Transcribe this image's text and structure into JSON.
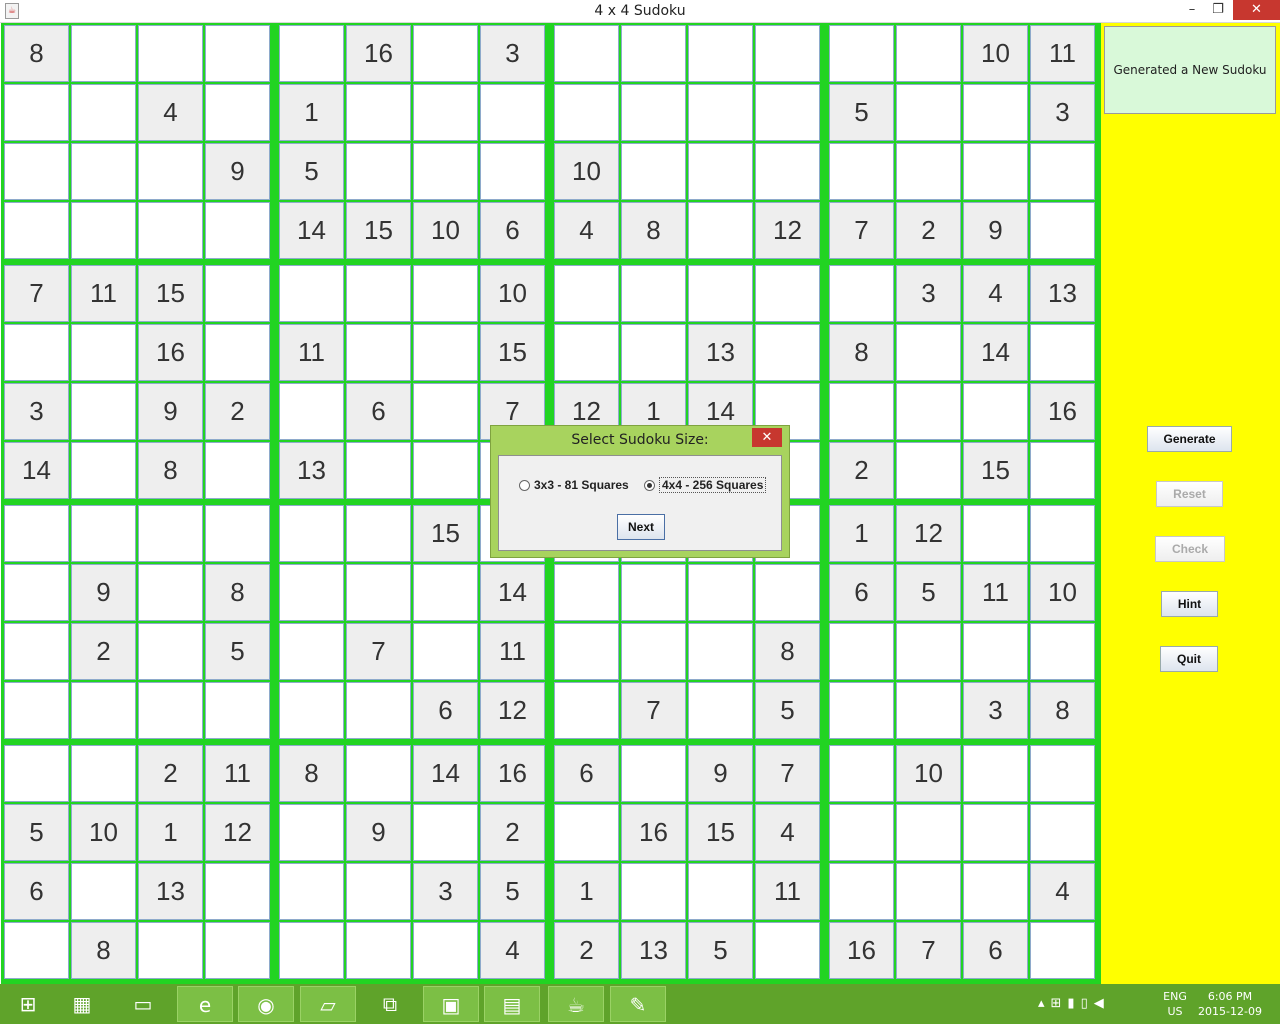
{
  "window": {
    "title": "4 x 4 Sudoku",
    "app_icon": "java-icon",
    "min": "–",
    "max": "❐",
    "close": "✕"
  },
  "grid": [
    [
      "8",
      "",
      "",
      "",
      "",
      "16",
      "",
      "3",
      "",
      "",
      "",
      "",
      "",
      "",
      "10",
      "11"
    ],
    [
      "",
      "",
      "4",
      "",
      "1",
      "",
      "",
      "",
      "",
      "",
      "",
      "",
      "5",
      "",
      "",
      "3"
    ],
    [
      "",
      "",
      "",
      "9",
      "5",
      "",
      "",
      "",
      "10",
      "",
      "",
      "",
      "",
      "",
      "",
      ""
    ],
    [
      "",
      "",
      "",
      "",
      "14",
      "15",
      "10",
      "6",
      "4",
      "8",
      "",
      "12",
      "7",
      "2",
      "9",
      ""
    ],
    [
      "7",
      "11",
      "15",
      "",
      "",
      "",
      "",
      "10",
      "",
      "",
      "",
      "",
      "",
      "3",
      "4",
      "13"
    ],
    [
      "",
      "",
      "16",
      "",
      "11",
      "",
      "",
      "15",
      "",
      "",
      "13",
      "",
      "8",
      "",
      "14",
      ""
    ],
    [
      "3",
      "",
      "9",
      "2",
      "",
      "6",
      "",
      "7",
      "12",
      "1",
      "14",
      "",
      "",
      "",
      "",
      "16"
    ],
    [
      "14",
      "",
      "8",
      "",
      "13",
      "",
      "",
      "",
      "",
      "",
      "",
      "",
      "2",
      "",
      "15",
      ""
    ],
    [
      "",
      "",
      "",
      "",
      "",
      "",
      "15",
      "",
      "",
      "",
      "",
      "",
      "1",
      "12",
      "",
      ""
    ],
    [
      "",
      "9",
      "",
      "8",
      "",
      "",
      "",
      "14",
      "",
      "",
      "",
      "",
      "6",
      "5",
      "11",
      "10"
    ],
    [
      "",
      "2",
      "",
      "5",
      "",
      "7",
      "",
      "11",
      "",
      "",
      "",
      "8",
      "",
      "",
      "",
      ""
    ],
    [
      "",
      "",
      "",
      "",
      "",
      "",
      "6",
      "12",
      "",
      "7",
      "",
      "5",
      "",
      "",
      "3",
      "8"
    ],
    [
      "",
      "",
      "2",
      "11",
      "8",
      "",
      "14",
      "16",
      "6",
      "",
      "9",
      "7",
      "",
      "10",
      "",
      ""
    ],
    [
      "5",
      "10",
      "1",
      "12",
      "",
      "9",
      "",
      "2",
      "",
      "16",
      "15",
      "4",
      "",
      "",
      "",
      ""
    ],
    [
      "6",
      "",
      "13",
      "",
      "",
      "",
      "3",
      "5",
      "1",
      "",
      "",
      "11",
      "",
      "",
      "",
      "4"
    ],
    [
      "",
      "8",
      "",
      "",
      "",
      "",
      "",
      "4",
      "2",
      "13",
      "5",
      "",
      "16",
      "7",
      "6",
      ""
    ]
  ],
  "given_mask": [
    "1000010100000011",
    "0010100000001001",
    "0001100010000000",
    "0000111111011110",
    "1110000100000111",
    "0010100100101010",
    "1011010111100001",
    "1010100000001010",
    "0000001000001100",
    "0101000100001111",
    "0101010100010000",
    "0000001101010011",
    "0011101110110100",
    "1111010101110000",
    "1010001110010001",
    "0100000111101110"
  ],
  "sidebar": {
    "status": "Generated a New Sudoku",
    "buttons": [
      "Generate",
      "Reset",
      "Check",
      "Hint",
      "Quit"
    ],
    "disabled": [
      "Reset",
      "Check"
    ]
  },
  "dialog": {
    "title": "Select Sudoku Size:",
    "close": "✕",
    "option_3x3": "3x3 - 81 Squares",
    "option_4x4": "4x4 - 256 Squares",
    "selected": "4x4 - 256 Squares",
    "next": "Next"
  },
  "taskbar": {
    "items": [
      "windows-start-icon",
      "control-panel-icon",
      "computer-icon",
      "internet-explorer-icon",
      "chrome-icon",
      "sticky-notes-icon",
      "remote-desktop-icon",
      "terminal-icon",
      "file-explorer-icon",
      "java-icon",
      "paint-icon"
    ],
    "language": "ENG",
    "region": "US",
    "time": "6:06 PM",
    "date": "2015-12-09"
  }
}
